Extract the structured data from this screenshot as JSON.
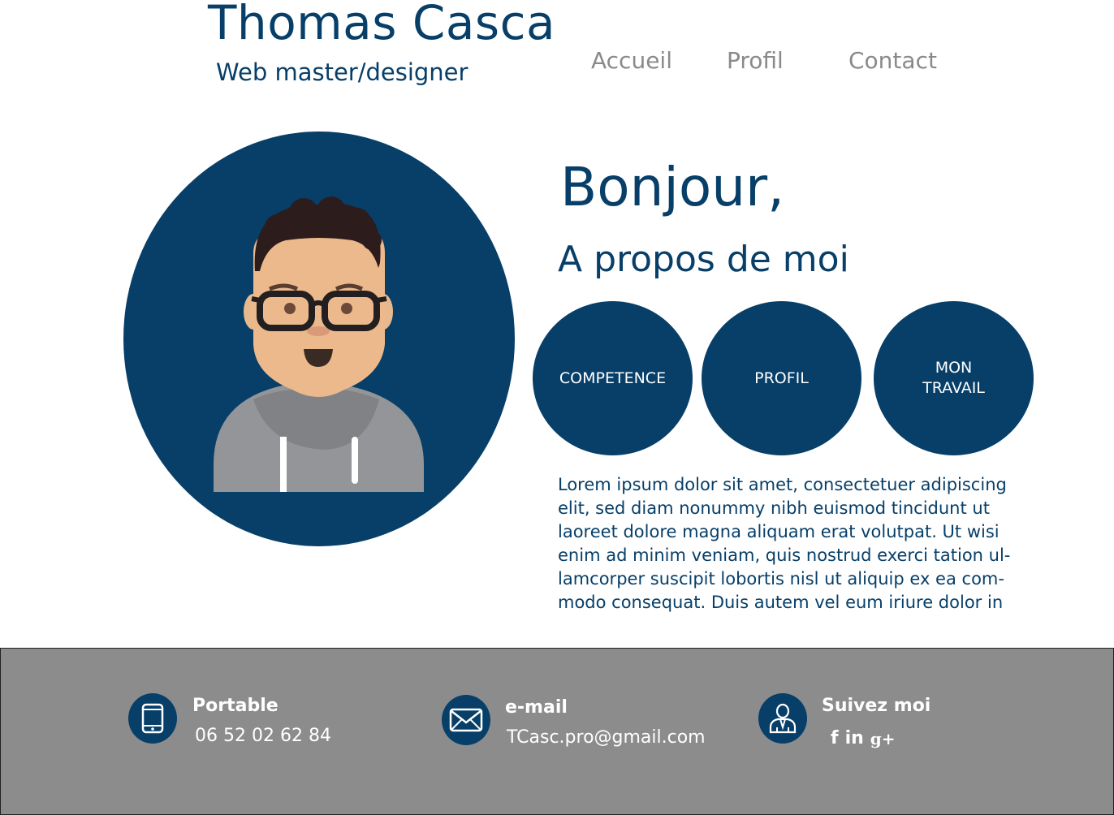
{
  "header": {
    "name": "Thomas Casca",
    "role": "Web master/designer"
  },
  "nav": {
    "accueil": "Accueil",
    "profil": "Profil",
    "contact": "Contact"
  },
  "hero": {
    "greeting": "Bonjour,",
    "subtitle": "A propos de moi",
    "buttons": {
      "competence": "COMPETENCE",
      "profil": "PROFIL",
      "travail": "MON\nTRAVAIL"
    },
    "about": "Lorem ipsum dolor sit amet, consectetuer adipiscing elit, sed diam nonummy nibh euismod tincidunt ut laoreet dolore magna aliquam erat volutpat. Ut wisi enim ad minim veniam, quis nostrud exerci tation ul-lamcorper suscipit lobortis nisl ut aliquip ex ea com-modo consequat. Duis autem vel eum iriure dolor in"
  },
  "footer": {
    "phone": {
      "label": "Portable",
      "value": "06 52 02 62 84",
      "icon": "phone-icon"
    },
    "email": {
      "label": "e-mail",
      "value": "TCasc.pro@gmail.com",
      "icon": "mail-icon"
    },
    "social": {
      "label": "Suivez moi",
      "icon": "person-icon",
      "facebook": "f",
      "linkedin": "in",
      "googleplus": "g+"
    }
  },
  "colors": {
    "primary": "#073f69",
    "nav_text": "#8a8a8a",
    "footer_bg": "#8c8c8c",
    "white": "#ffffff"
  }
}
